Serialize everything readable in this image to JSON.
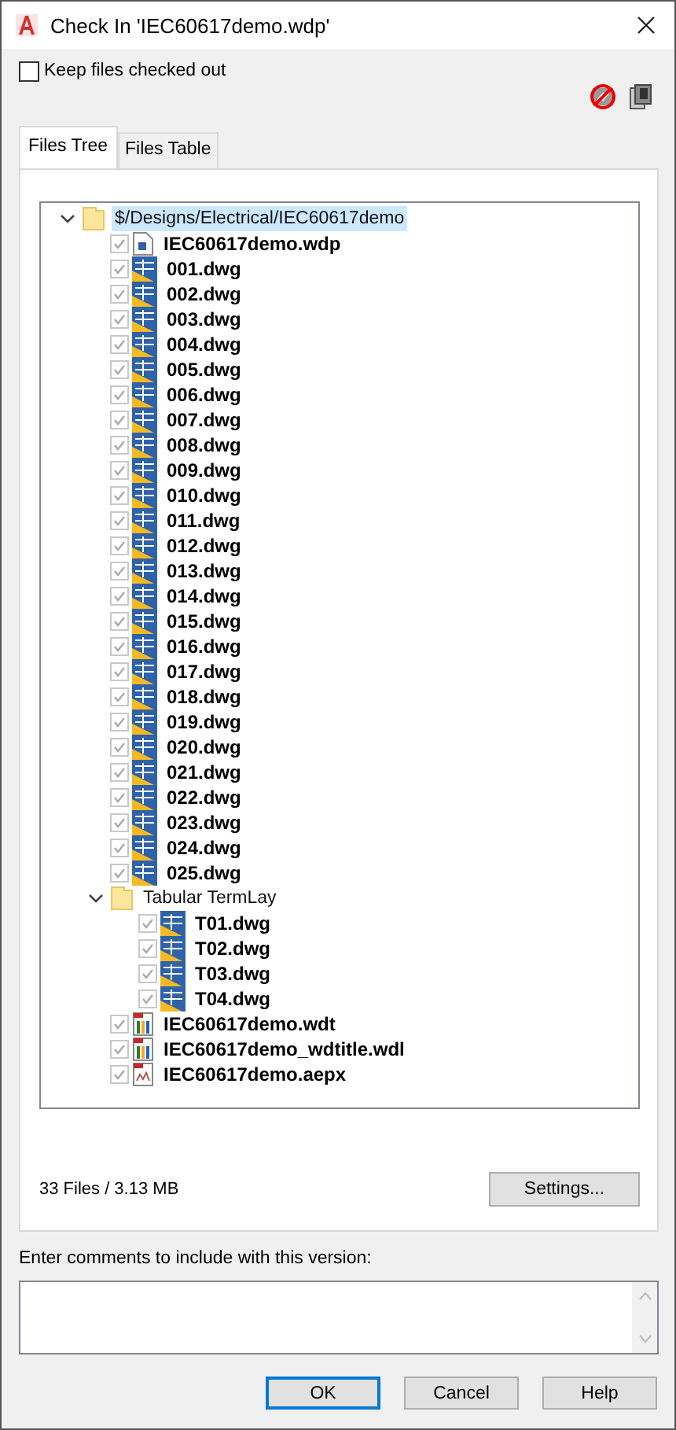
{
  "window": {
    "title": "Check In 'IEC60617demo.wdp'"
  },
  "keep_checked_out": {
    "label": "Keep files checked out",
    "checked": false
  },
  "tabs": [
    {
      "label": "Files Tree",
      "selected": true
    },
    {
      "label": "Files Table",
      "selected": false
    }
  ],
  "tree": [
    {
      "kind": "folder",
      "label": "$/Designs/Electrical/IEC60617demo",
      "expanded": true,
      "selected": true,
      "children": [
        {
          "kind": "wdp",
          "label": "IEC60617demo.wdp",
          "checked": true,
          "selected": false
        },
        {
          "kind": "dwg",
          "label": "001.dwg",
          "checked": true,
          "selected": false
        },
        {
          "kind": "dwg",
          "label": "002.dwg",
          "checked": true,
          "selected": false
        },
        {
          "kind": "dwg",
          "label": "003.dwg",
          "checked": true,
          "selected": false
        },
        {
          "kind": "dwg",
          "label": "004.dwg",
          "checked": true,
          "selected": false
        },
        {
          "kind": "dwg",
          "label": "005.dwg",
          "checked": true,
          "selected": false
        },
        {
          "kind": "dwg",
          "label": "006.dwg",
          "checked": true,
          "selected": false
        },
        {
          "kind": "dwg",
          "label": "007.dwg",
          "checked": true,
          "selected": false
        },
        {
          "kind": "dwg",
          "label": "008.dwg",
          "checked": true,
          "selected": false
        },
        {
          "kind": "dwg",
          "label": "009.dwg",
          "checked": true,
          "selected": false
        },
        {
          "kind": "dwg",
          "label": "010.dwg",
          "checked": true,
          "selected": false
        },
        {
          "kind": "dwg",
          "label": "011.dwg",
          "checked": true,
          "selected": false
        },
        {
          "kind": "dwg",
          "label": "012.dwg",
          "checked": true,
          "selected": false
        },
        {
          "kind": "dwg",
          "label": "013.dwg",
          "checked": true,
          "selected": false
        },
        {
          "kind": "dwg",
          "label": "014.dwg",
          "checked": true,
          "selected": false
        },
        {
          "kind": "dwg",
          "label": "015.dwg",
          "checked": true,
          "selected": false
        },
        {
          "kind": "dwg",
          "label": "016.dwg",
          "checked": true,
          "selected": false
        },
        {
          "kind": "dwg",
          "label": "017.dwg",
          "checked": true,
          "selected": false
        },
        {
          "kind": "dwg",
          "label": "018.dwg",
          "checked": true,
          "selected": false
        },
        {
          "kind": "dwg",
          "label": "019.dwg",
          "checked": true,
          "selected": false
        },
        {
          "kind": "dwg",
          "label": "020.dwg",
          "checked": true,
          "selected": false
        },
        {
          "kind": "dwg",
          "label": "021.dwg",
          "checked": true,
          "selected": false
        },
        {
          "kind": "dwg",
          "label": "022.dwg",
          "checked": true,
          "selected": false
        },
        {
          "kind": "dwg",
          "label": "023.dwg",
          "checked": true,
          "selected": false
        },
        {
          "kind": "dwg",
          "label": "024.dwg",
          "checked": true,
          "selected": false
        },
        {
          "kind": "dwg",
          "label": "025.dwg",
          "checked": true,
          "selected": false
        },
        {
          "kind": "folder",
          "label": "Tabular TermLay",
          "expanded": true,
          "selected": false,
          "children": [
            {
              "kind": "dwg",
              "label": "T01.dwg",
              "checked": true,
              "selected": false
            },
            {
              "kind": "dwg",
              "label": "T02.dwg",
              "checked": true,
              "selected": false
            },
            {
              "kind": "dwg",
              "label": "T03.dwg",
              "checked": true,
              "selected": false
            },
            {
              "kind": "dwg",
              "label": "T04.dwg",
              "checked": true,
              "selected": false
            }
          ]
        },
        {
          "kind": "wdt",
          "label": "IEC60617demo.wdt",
          "checked": true,
          "selected": false
        },
        {
          "kind": "wdt",
          "label": "IEC60617demo_wdtitle.wdl",
          "checked": true,
          "selected": false
        },
        {
          "kind": "aepx",
          "label": "IEC60617demo.aepx",
          "checked": true,
          "selected": false
        }
      ]
    }
  ],
  "summary": "33 Files / 3.13 MB",
  "settings_button": "Settings...",
  "comments": {
    "label": "Enter comments to include with this version:"
  },
  "buttons": [
    {
      "label": "OK",
      "default": true
    },
    {
      "label": "Cancel",
      "default": false
    },
    {
      "label": "Help",
      "default": false
    }
  ]
}
